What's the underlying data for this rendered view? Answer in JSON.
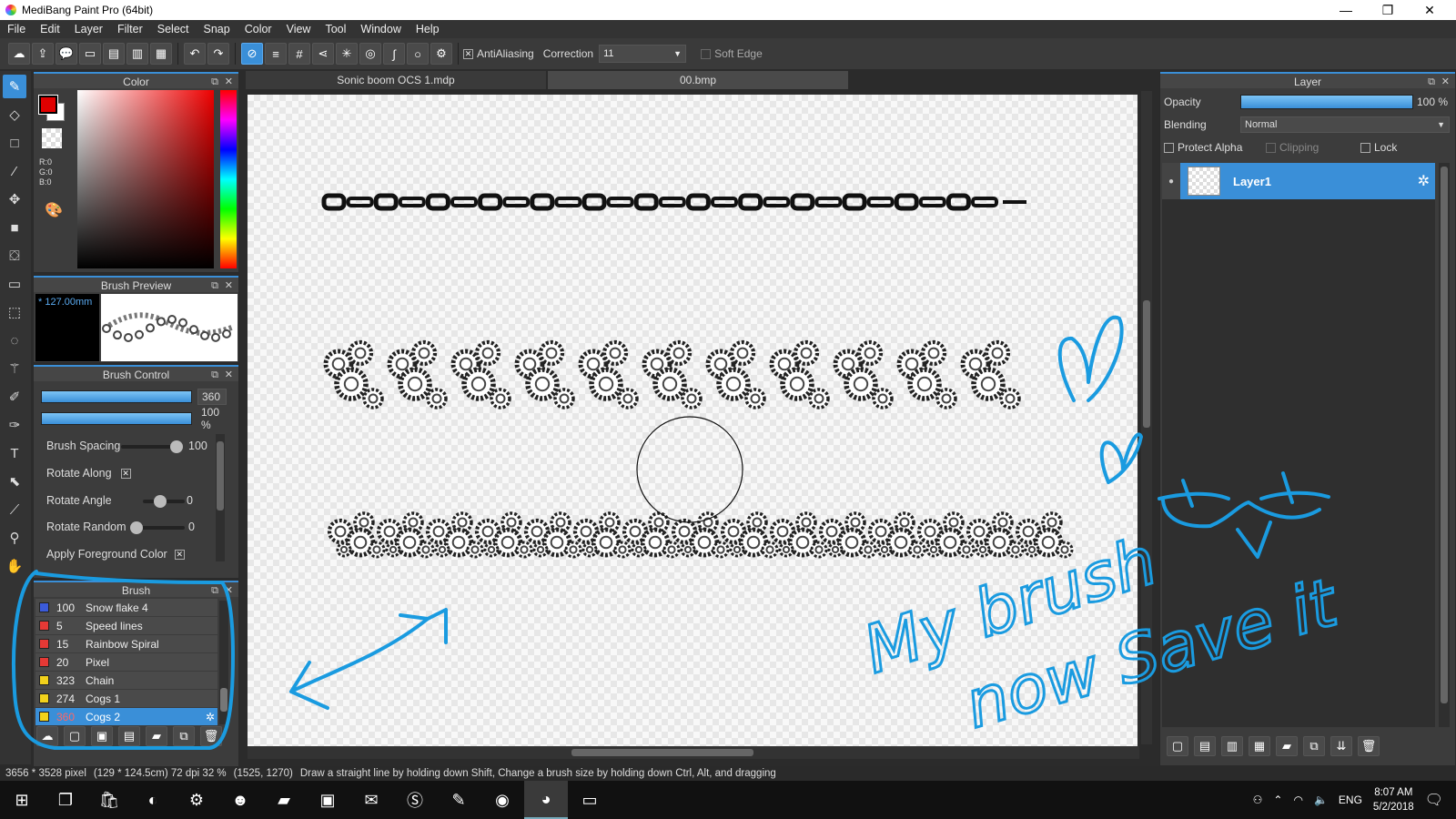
{
  "window": {
    "title": "MediBang Paint Pro (64bit)",
    "minimize": "—",
    "restore": "❐",
    "close": "✕"
  },
  "menu": [
    "File",
    "Edit",
    "Layer",
    "Filter",
    "Select",
    "Snap",
    "Color",
    "View",
    "Tool",
    "Window",
    "Help"
  ],
  "toolbar": {
    "antialiasing_label": "AntiAliasing",
    "correction_label": "Correction",
    "correction_value": "11",
    "soft_edge_label": "Soft Edge"
  },
  "color_panel": {
    "title": "Color",
    "rgb": {
      "r": "R:0",
      "g": "G:0",
      "b": "B:0"
    },
    "fg_color": "#e00000",
    "bg_color": "#ffffff"
  },
  "brush_preview": {
    "title": "Brush Preview",
    "size": "127.00mm"
  },
  "brush_control": {
    "title": "Brush Control",
    "size_value": "360",
    "opacity_value": "100 %",
    "spacing_label": "Brush Spacing",
    "spacing_value": "100",
    "rotate_along_label": "Rotate Along",
    "rotate_angle_label": "Rotate Angle",
    "rotate_angle_value": "0",
    "rotate_random_label": "Rotate Random",
    "rotate_random_value": "0",
    "apply_fg_label": "Apply Foreground Color"
  },
  "brush_list": {
    "title": "Brush",
    "items": [
      {
        "size": "100",
        "name": "Snow flake 4",
        "color": "#3b5bdb"
      },
      {
        "size": "5",
        "name": "Speed lines",
        "color": "#e53935"
      },
      {
        "size": "15",
        "name": "Rainbow Spiral",
        "color": "#e53935"
      },
      {
        "size": "20",
        "name": "Pixel",
        "color": "#e53935"
      },
      {
        "size": "323",
        "name": "Chain",
        "color": "#f2d21b"
      },
      {
        "size": "274",
        "name": "Cogs 1",
        "color": "#f2d21b"
      },
      {
        "size": "360",
        "name": "Cogs 2",
        "color": "#f2d21b"
      }
    ]
  },
  "tabs": [
    "Sonic boom OCS 1.mdp",
    "00.bmp"
  ],
  "layer_panel": {
    "title": "Layer",
    "opacity_label": "Opacity",
    "opacity_value": "100 %",
    "blending_label": "Blending",
    "blending_value": "Normal",
    "protect_alpha_label": "Protect Alpha",
    "clipping_label": "Clipping",
    "lock_label": "Lock",
    "layer_name": "Layer1"
  },
  "status": {
    "dimensions": "3656 * 3528 pixel",
    "size_info": "(129 * 124.5cm)  72 dpi  32 %",
    "coords": "(1525, 1270)",
    "hint": "Draw a straight line by holding down Shift, Change a brush size by holding down Ctrl, Alt, and dragging"
  },
  "taskbar": {
    "lang": "ENG",
    "time": "8:07 AM",
    "date": "5/2/2018"
  },
  "annotation": {
    "line1": "My brush",
    "line2": "now Save it",
    "color": "#1a9be0"
  }
}
